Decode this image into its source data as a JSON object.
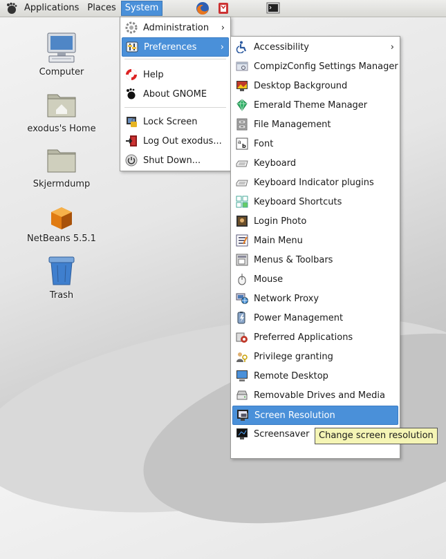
{
  "panel": {
    "menus": [
      "Applications",
      "Places",
      "System"
    ]
  },
  "desktop": {
    "icons": [
      "Computer",
      "exodus's Home",
      "Skjermdump",
      "NetBeans 5.5.1",
      "Trash"
    ]
  },
  "system_menu": {
    "items": [
      "Administration",
      "Preferences",
      "Help",
      "About GNOME",
      "Lock Screen",
      "Log Out exodus...",
      "Shut Down..."
    ]
  },
  "preferences_menu": {
    "items": [
      "Accessibility",
      "CompizConfig Settings Manager",
      "Desktop Background",
      "Emerald Theme Manager",
      "File Management",
      "Font",
      "Keyboard",
      "Keyboard Indicator plugins",
      "Keyboard Shortcuts",
      "Login Photo",
      "Main Menu",
      "Menus & Toolbars",
      "Mouse",
      "Network Proxy",
      "Power Management",
      "Preferred Applications",
      "Privilege granting",
      "Remote Desktop",
      "Removable Drives and Media",
      "Screen Resolution",
      "Screensaver"
    ],
    "highlighted": "Screen Resolution"
  },
  "tooltip": "Change screen resolution",
  "colors": {
    "highlight": "#4a90d9",
    "tooltip_bg": "#f5f5b5"
  }
}
